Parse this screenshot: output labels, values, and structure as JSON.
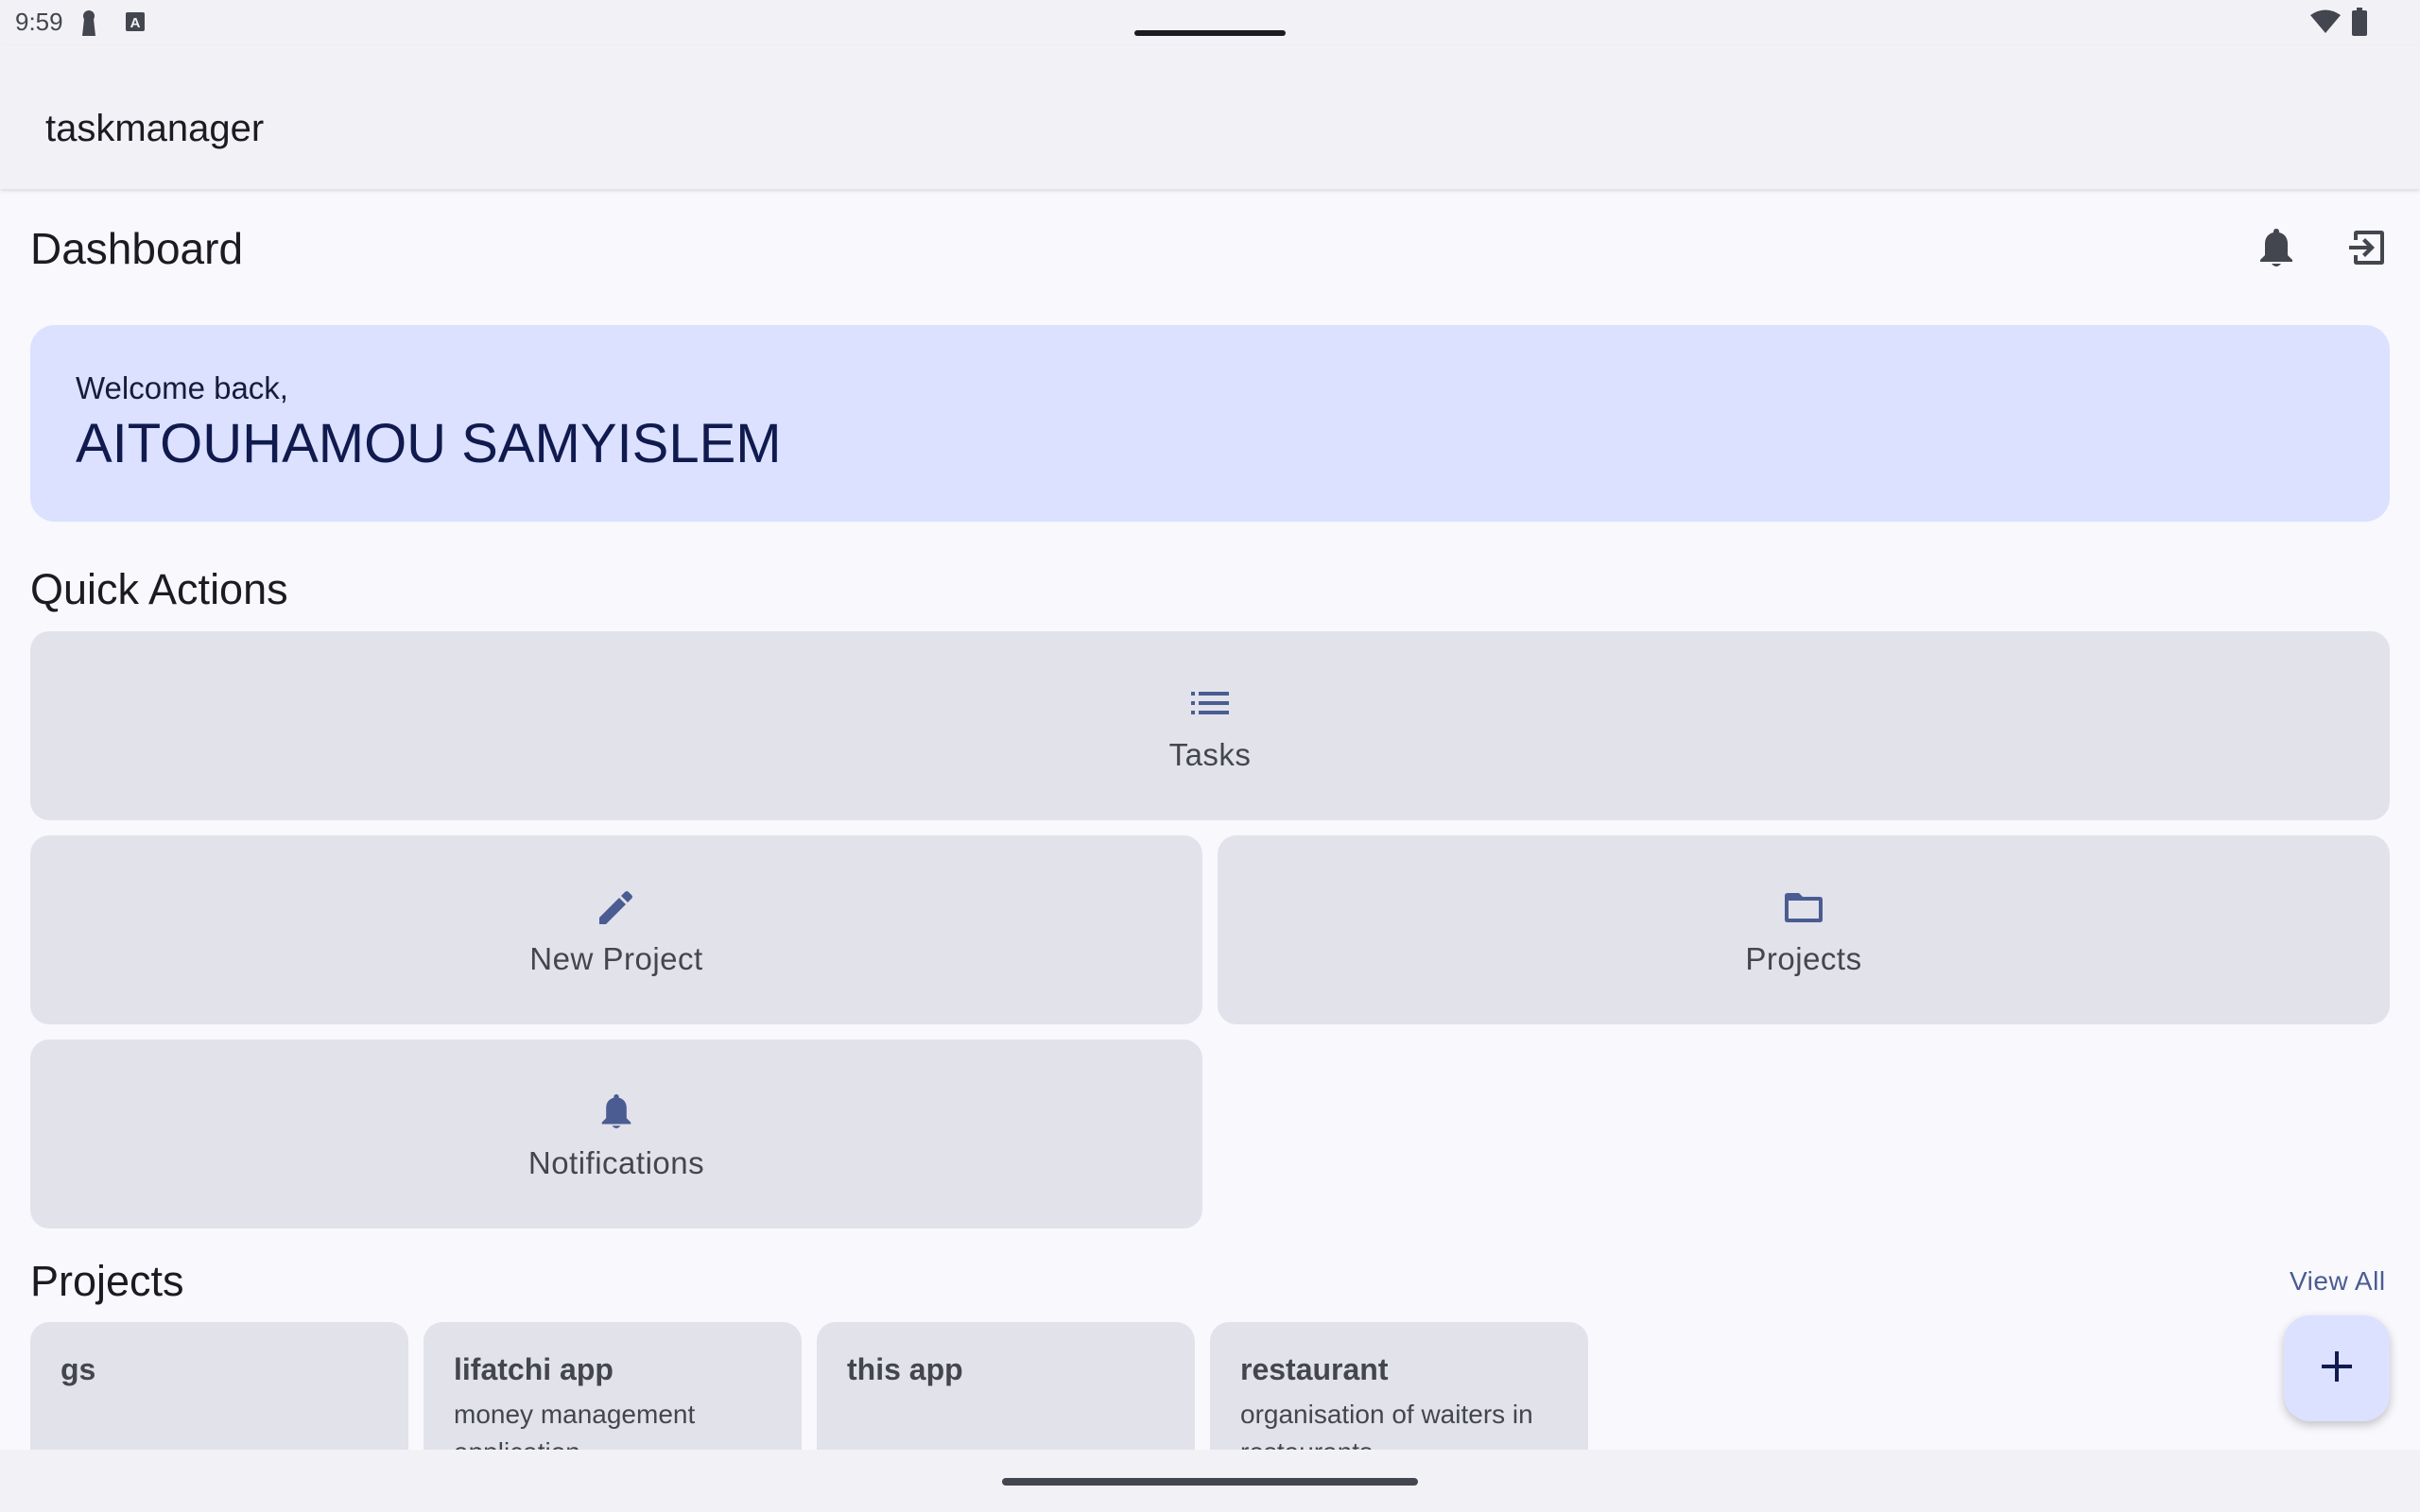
{
  "status_bar": {
    "time": "9:59",
    "left_icons": [
      "keyhole-icon",
      "keyboard-a-icon"
    ],
    "right_icons": [
      "wifi-icon",
      "battery-icon"
    ]
  },
  "app_bar": {
    "title": "taskmanager"
  },
  "header": {
    "title": "Dashboard",
    "actions": [
      {
        "name": "notifications",
        "icon": "bell-icon"
      },
      {
        "name": "logout",
        "icon": "logout-icon"
      }
    ]
  },
  "welcome": {
    "label": "Welcome back,",
    "name": "AITOUHAMOU SAMYISLEM"
  },
  "quick_actions": {
    "title": "Quick Actions",
    "items": [
      {
        "label": "Tasks",
        "icon": "list-icon"
      },
      {
        "label": "New Project",
        "icon": "pencil-icon"
      },
      {
        "label": "Projects",
        "icon": "folder-icon"
      },
      {
        "label": "Notifications",
        "icon": "bell-icon"
      }
    ]
  },
  "projects": {
    "title": "Projects",
    "view_all": "View All",
    "items": [
      {
        "name": "gs",
        "description": ""
      },
      {
        "name": "lifatchi app",
        "description": "money management application"
      },
      {
        "name": "this app",
        "description": ""
      },
      {
        "name": "restaurant",
        "description": "organisation of waiters in restaurants"
      }
    ]
  },
  "fab": {
    "icon": "plus-icon"
  },
  "colors": {
    "background": "#f8f8fd",
    "surface": "#f2f1f6",
    "tile": "#e2e2ea",
    "primary_container": "#dbe1ff",
    "primary": "#4a5c92"
  }
}
